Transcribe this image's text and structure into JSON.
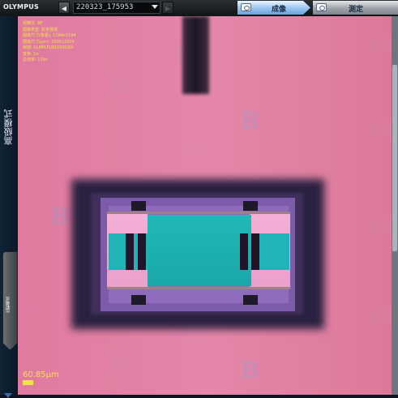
{
  "app": {
    "logo": "OLYMPUS"
  },
  "toolbar": {
    "prev_label": "◀",
    "next_label": "▶",
    "file_combo": {
      "value": "220323_175953"
    },
    "tabs": [
      {
        "label": "成像"
      },
      {
        "label": "測定"
      }
    ]
  },
  "left_panel": {
    "advanced_mode_label": "高級模式",
    "compare_tab_label": "比較模式"
  },
  "overlay": {
    "lines": [
      "观察法: BF",
      "图像类型: 彩色视频",
      "图像尺寸(像素): 1194x1194",
      "图像尺寸(μm): 2026x2026",
      "物镜: XLMPLFLN100XDSX",
      "变焦: 1x",
      "总倍率: 139x"
    ],
    "scale_label": "60.85μm"
  },
  "colors": {
    "accent": "#f2e14a",
    "background_pink": "#e587aa",
    "teal": "#21b8b8"
  }
}
